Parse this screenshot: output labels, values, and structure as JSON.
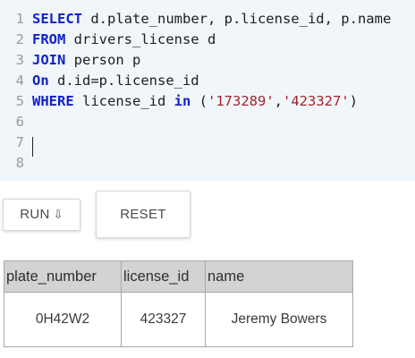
{
  "editor": {
    "lines": [
      {
        "num": "1",
        "tokens": [
          {
            "t": "SELECT",
            "k": "kw"
          },
          {
            "t": " d.plate_number, p.license_id, p.name",
            "k": ""
          }
        ]
      },
      {
        "num": "2",
        "tokens": [
          {
            "t": "FROM",
            "k": "kw"
          },
          {
            "t": " drivers_license d",
            "k": ""
          }
        ]
      },
      {
        "num": "3",
        "tokens": [
          {
            "t": "JOIN",
            "k": "kw"
          },
          {
            "t": " person p",
            "k": ""
          }
        ]
      },
      {
        "num": "4",
        "tokens": [
          {
            "t": "On",
            "k": "kw"
          },
          {
            "t": " d.id=p.license_id",
            "k": ""
          }
        ]
      },
      {
        "num": "5",
        "tokens": [
          {
            "t": "WHERE",
            "k": "kw"
          },
          {
            "t": " license_id ",
            "k": ""
          },
          {
            "t": "in",
            "k": "kw"
          },
          {
            "t": " (",
            "k": ""
          },
          {
            "t": "'173289'",
            "k": "str"
          },
          {
            "t": ",",
            "k": ""
          },
          {
            "t": "'423327'",
            "k": "str"
          },
          {
            "t": ")",
            "k": ""
          }
        ]
      },
      {
        "num": "6",
        "tokens": []
      },
      {
        "num": "7",
        "tokens": []
      },
      {
        "num": "8",
        "tokens": []
      }
    ]
  },
  "buttons": {
    "run_label": "RUN",
    "run_arrow": "⇩",
    "reset_label": "RESET"
  },
  "results": {
    "columns": [
      "plate_number",
      "license_id",
      "name"
    ],
    "rows": [
      [
        "0H42W2",
        "423327",
        "Jeremy Bowers"
      ]
    ]
  },
  "colors": {
    "keyword": "#1220c8",
    "string": "#a3222a",
    "editor_bg": "#f0f6fa",
    "table_header_bg": "#d3d3d3"
  }
}
